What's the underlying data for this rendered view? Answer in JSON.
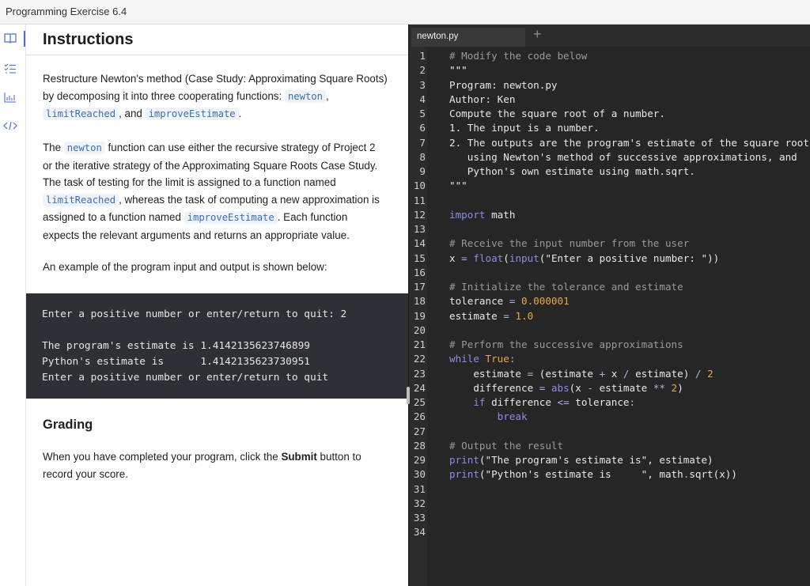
{
  "window_title": "Programming Exercise 6.4",
  "rail": {
    "icons": [
      "book-icon",
      "checklist-icon",
      "bar-chart-icon",
      "code-icon"
    ]
  },
  "instructions": {
    "heading": "Instructions",
    "p1": {
      "t1": "Restructure Newton's method (Case Study: Approximating Square Roots)",
      "t2": "by decomposing it into three cooperating functions: ",
      "c1": "newton",
      "t3": ",",
      "c2": "limitReached",
      "t4": ", and ",
      "c3": "improveEstimate",
      "t5": "."
    },
    "p2": {
      "t1": "The ",
      "c1": "newton",
      "t2": " function can use either the recursive strategy of Project 2",
      "t3": "or the iterative strategy of the Approximating Square Roots Case Study.",
      "t4": "The task of testing for the limit is assigned to a function named",
      "c2": "limitReached",
      "t5": ", whereas the task of computing a new approximation is",
      "t6": "assigned to a function named ",
      "c3": "improveEstimate",
      "t7": ". Each function",
      "t8": "expects the relevant arguments and returns an appropriate value."
    },
    "p3": "An example of the program input and output is shown below:",
    "terminal": [
      "Enter a positive number or enter/return to quit: 2",
      "The program's estimate is 1.4142135623746899",
      "Python's estimate is      1.4142135623730951",
      "Enter a positive number or enter/return to quit"
    ],
    "grading_heading": "Grading",
    "grading": {
      "t1": "When you have completed your program, click the ",
      "b1": "Submit",
      "t2": " button to",
      "t3": "record your score."
    }
  },
  "editor": {
    "tab_label": "newton.py",
    "add_tab_label": "+",
    "line_numbers": [
      "1",
      "2",
      "3",
      "4",
      "5",
      "6",
      "7",
      "8",
      "9",
      "10",
      "11",
      "12",
      "13",
      "14",
      "15",
      "16",
      "17",
      "18",
      "19",
      "20",
      "21",
      "22",
      "23",
      "24",
      "25",
      "26",
      "27",
      "28",
      "29",
      "30",
      "31",
      "32",
      "33",
      "34"
    ],
    "code": {
      "l1": "# Modify the code below",
      "l2": "\"\"\"",
      "l3": "Program: newton.py",
      "l4": "Author: Ken",
      "l5": "Compute the square root of a number.",
      "l6": "1. The input is a number.",
      "l7": "2. The outputs are the program's estimate of the square root",
      "l8": "   using Newton's method of successive approximations, and",
      "l9": "   Python's own estimate using math.sqrt.",
      "l10": "\"\"\"",
      "l12a": "import",
      "l12b": " math",
      "l14": "# Receive the input number from the user",
      "l15a": "x ",
      "l15b": "=",
      "l15c": " ",
      "l15d": "float",
      "l15e": "(",
      "l15f": "input",
      "l15g": "(\"Enter a positive number: \"))",
      "l17": "# Initialize the tolerance and estimate",
      "l18a": "tolerance ",
      "l18b": "=",
      "l18c": " ",
      "l18d": "0.000001",
      "l19a": "estimate ",
      "l19b": "=",
      "l19c": " ",
      "l19d": "1.0",
      "l21": "# Perform the successive approximations",
      "l22a": "while",
      "l22b": " ",
      "l22c": "True",
      "l22d": ":",
      "l23a": "    estimate ",
      "l23b": "=",
      "l23c": " (estimate ",
      "l23d": "+",
      "l23e": " x ",
      "l23f": "/",
      "l23g": " estimate) ",
      "l23h": "/",
      "l23i": " ",
      "l23j": "2",
      "l24a": "    difference ",
      "l24b": "=",
      "l24c": " ",
      "l24d": "abs",
      "l24e": "(x ",
      "l24f": "-",
      "l24g": " estimate ",
      "l24h": "**",
      "l24i": " ",
      "l24j": "2",
      "l24k": ")",
      "l25a": "    ",
      "l25b": "if",
      "l25c": " difference ",
      "l25d": "<=",
      "l25e": " tolerance",
      "l25f": ":",
      "l26a": "        ",
      "l26b": "break",
      "l28": "# Output the result",
      "l29a": "print",
      "l29b": "(\"The program's estimate is\", estimate)",
      "l30a": "print",
      "l30b": "(\"Python's estimate is     \", math",
      "l30c": ".",
      "l30d": "sqrt(x))"
    }
  },
  "colors": {
    "accent": "#4a6fd0",
    "editor_bg": "#262626",
    "terminal_bg": "#2e3034",
    "keyword": "#8a8ee8",
    "number": "#e6a84a",
    "comment": "#9a9a9a"
  }
}
